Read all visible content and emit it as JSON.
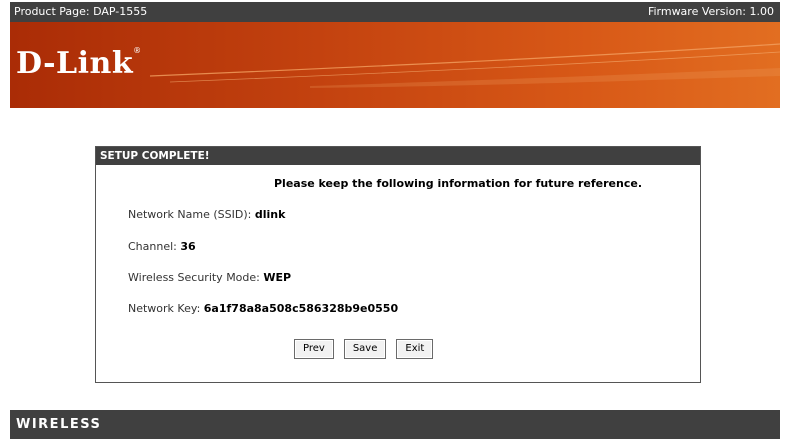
{
  "topbar": {
    "product": "Product Page: DAP-1555",
    "firmware": "Firmware Version: 1.00"
  },
  "banner": {
    "logo": "D-Link",
    "trademark": "®"
  },
  "panel": {
    "title": "SETUP COMPLETE!",
    "notice": "Please keep the following information for future reference.",
    "ssid_label": "Network Name (SSID): ",
    "ssid_value": "dlink",
    "channel_label": "Channel: ",
    "channel_value": "36",
    "security_label": "Wireless Security Mode: ",
    "security_value": "WEP",
    "key_label": "Network Key: ",
    "key_value": "6a1f78a8a508c586328b9e0550"
  },
  "buttons": {
    "prev": "Prev",
    "save": "Save",
    "exit": "Exit"
  },
  "footer": {
    "label": "WIRELESS"
  }
}
